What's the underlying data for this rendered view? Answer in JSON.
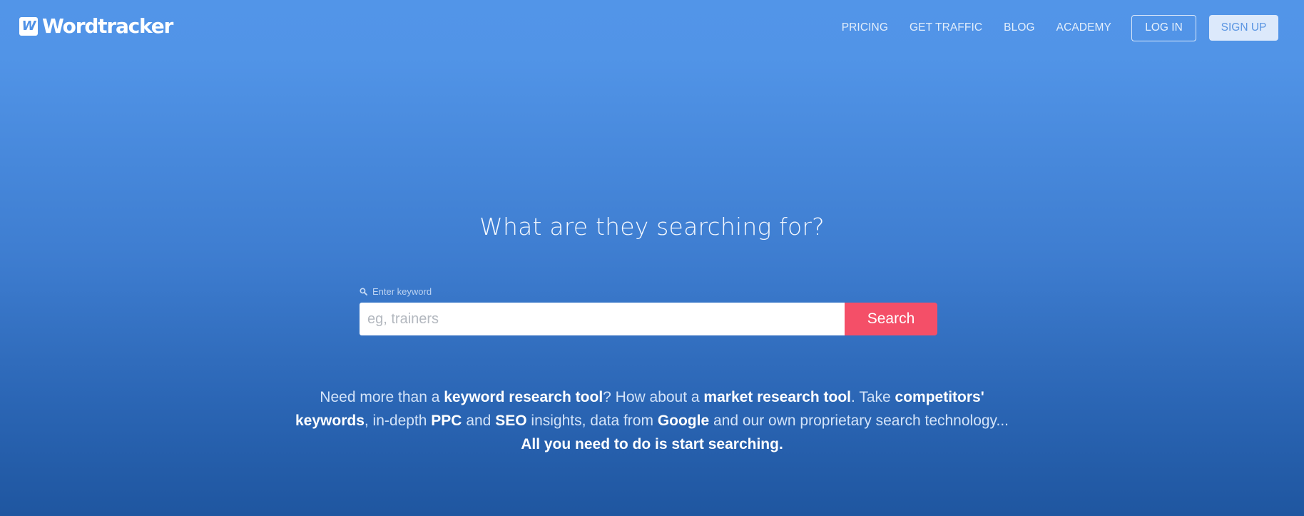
{
  "header": {
    "logo": {
      "icon_letter": "W",
      "text": "Wordtracker",
      "icon": "wordtracker-logo-icon"
    },
    "nav": [
      {
        "label": "PRICING"
      },
      {
        "label": "GET TRAFFIC"
      },
      {
        "label": "BLOG"
      },
      {
        "label": "ACADEMY"
      }
    ],
    "login_label": "LOG IN",
    "signup_label": "SIGN UP"
  },
  "hero": {
    "title": "What are they searching for?",
    "search": {
      "label": "Enter keyword",
      "label_icon": "search-icon",
      "placeholder": "eg, trainers",
      "value": "",
      "button_label": "Search"
    },
    "blurb": [
      {
        "text": "Need more than a ",
        "bold": false
      },
      {
        "text": "keyword research tool",
        "bold": true
      },
      {
        "text": "? How about a ",
        "bold": false
      },
      {
        "text": "market research tool",
        "bold": true
      },
      {
        "text": ". Take ",
        "bold": false
      },
      {
        "text": "competitors' keywords",
        "bold": true
      },
      {
        "text": ", in-depth ",
        "bold": false
      },
      {
        "text": "PPC",
        "bold": true
      },
      {
        "text": " and ",
        "bold": false
      },
      {
        "text": "SEO",
        "bold": true
      },
      {
        "text": " insights, data from ",
        "bold": false
      },
      {
        "text": "Google",
        "bold": true
      },
      {
        "text": " and our own proprietary search technology... ",
        "bold": false
      },
      {
        "text": "All you need to do is start searching.",
        "bold": true
      }
    ]
  },
  "colors": {
    "background_top": "#5295e8",
    "background_bottom": "#1f56a0",
    "search_button": "#f44f68",
    "signup_bg": "#dce9fb"
  }
}
